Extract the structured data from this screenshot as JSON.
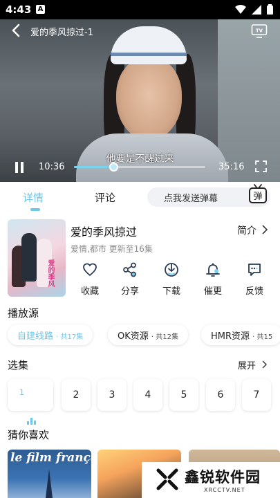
{
  "status_bar": {
    "time": "4:43",
    "notification_badge": "A"
  },
  "player": {
    "title": "爱的季风掠过-1",
    "subtitle_text": "他要是不醒过来",
    "current_time": "10:36",
    "duration": "35:16",
    "progress_fraction": 0.3
  },
  "tabs": {
    "detail": "详情",
    "comment": "评论",
    "danmu_placeholder": "点我发送弹幕",
    "danmu_button": "弹"
  },
  "show": {
    "title": "爱的季风掠过",
    "meta": "爱情,都市 更新至16集",
    "intro_label": "简介",
    "poster_title": "爱的季风"
  },
  "actions": [
    {
      "label": "收藏",
      "icon": "heart-icon"
    },
    {
      "label": "分享",
      "icon": "share-icon"
    },
    {
      "label": "下载",
      "icon": "download-icon"
    },
    {
      "label": "催更",
      "icon": "bell-icon"
    },
    {
      "label": "反馈",
      "icon": "feedback-icon"
    }
  ],
  "sources": {
    "title": "播放源",
    "items": [
      {
        "name": "自建线路",
        "count": "· 共17集",
        "active": true
      },
      {
        "name": "OK资源",
        "count": "· 共12集",
        "active": false
      },
      {
        "name": "HMR资源",
        "count": "· 共15",
        "active": false
      }
    ]
  },
  "episodes": {
    "title": "选集",
    "expand_label": "展开",
    "items": [
      "1",
      "2",
      "3",
      "4",
      "5",
      "6",
      "7"
    ],
    "playing": "1"
  },
  "recommend": {
    "title": "猜你喜欢",
    "first_title": "le film français"
  },
  "watermark": {
    "name": "鑫锐软件园",
    "url": "XRCCTV.NET"
  },
  "colors": {
    "accent": "#6cc9e6"
  }
}
